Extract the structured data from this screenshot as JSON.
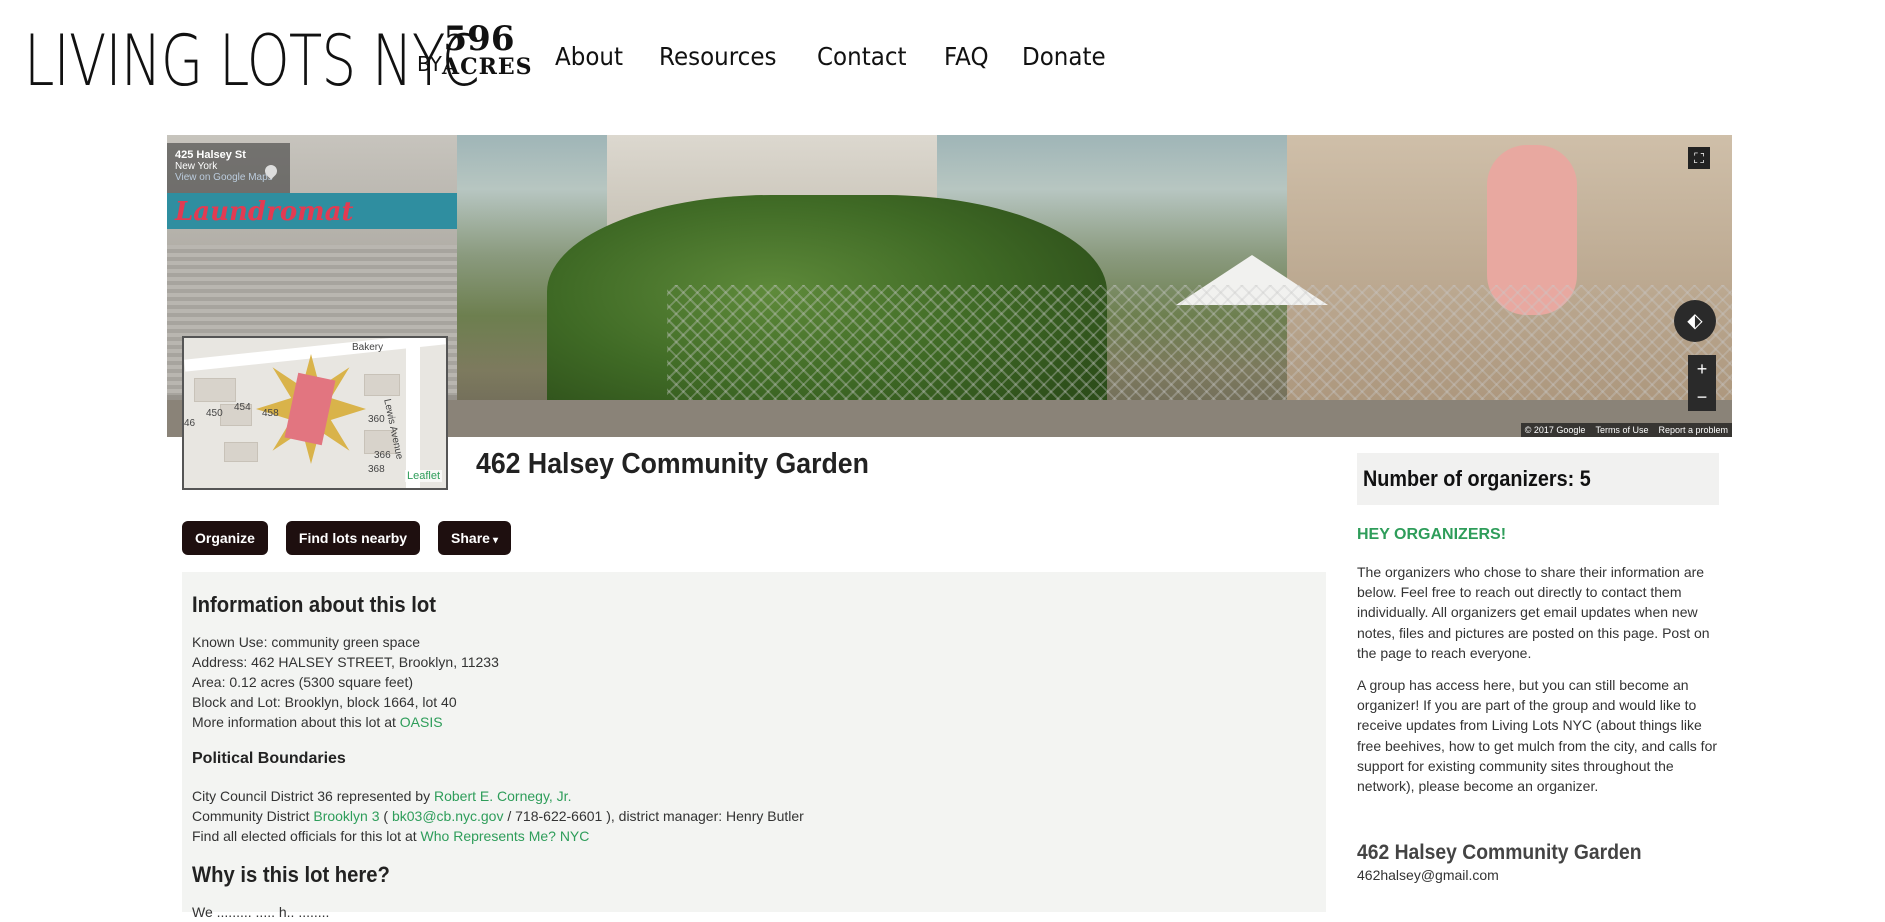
{
  "header": {
    "logo_main": "LIVING LOTS NYC",
    "logo_by": "BY",
    "logo_num": "596",
    "logo_acres": "ACRES",
    "nav": [
      "About",
      "Resources",
      "Contact",
      "FAQ",
      "Donate"
    ]
  },
  "streetview": {
    "address_line1": "425 Halsey St",
    "address_line2": "New York",
    "address_link": "View on Google Maps",
    "sign_text": "Laundromat",
    "copyright": "© 2017 Google",
    "terms": "Terms of Use",
    "report": "Report a problem",
    "zoom_in": "+",
    "zoom_out": "−"
  },
  "minimap": {
    "labels": [
      "Bakery",
      "Lewis Avenue",
      "450",
      "454",
      "458",
      "360",
      "366",
      "368",
      "46"
    ],
    "attribution": "Leaflet"
  },
  "lot": {
    "title": "462 Halsey Community Garden"
  },
  "actions": {
    "organize": "Organize",
    "find_nearby": "Find lots nearby",
    "share": "Share"
  },
  "info": {
    "heading": "Information about this lot",
    "known_use": "Known Use: community green space",
    "address": "Address: 462 HALSEY STREET, Brooklyn, 11233",
    "area": "Area: 0.12 acres (5300 square feet)",
    "block_lot": "Block and Lot: Brooklyn, block 1664, lot 40",
    "more_info_prefix": "More information about this lot at ",
    "more_info_link": "OASIS",
    "political_heading": "Political Boundaries",
    "council_prefix": "City Council District 36 represented by ",
    "council_link": "Robert E. Cornegy, Jr.",
    "cd_prefix": "Community District ",
    "cd_link": "Brooklyn 3",
    "cd_paren_open": " ( ",
    "cd_email": "bk03@cb.nyc.gov",
    "cd_suffix": " / 718-622-6601 ), district manager: Henry Butler",
    "elected_prefix": "Find all elected officials for this lot at ",
    "elected_link": "Who Represents Me? NYC",
    "why_heading": "Why is this lot here?",
    "why_text_cut": "We ......... ..... h.. ........"
  },
  "sidebar": {
    "organizers_count": "Number of organizers: 5",
    "hey": "HEY ORGANIZERS!",
    "para1": "The organizers who chose to share their information are below. Feel free to reach out directly to contact them individually. All organizers get email updates when new notes, files and pictures are posted on this page. Post on the page to reach everyone.",
    "para2": "A group has access here, but you can still become an organizer! If you are part of the group and would like to receive updates from Living Lots NYC (about things like free beehives, how to get mulch from the city, and calls for support for existing community sites throughout the network), please become an organizer.",
    "group_name": "462 Halsey Community Garden",
    "group_email": "462halsey@gmail.com"
  },
  "colors": {
    "accent_green": "#2e9d5a",
    "button_dark": "#1e0f0f",
    "panel_bg": "#f3f4f2"
  }
}
